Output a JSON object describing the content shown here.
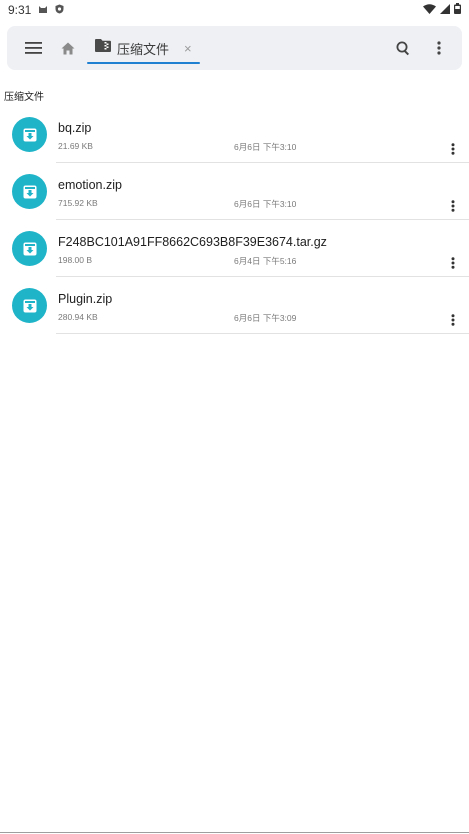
{
  "status_bar": {
    "time": "9:31",
    "icons": [
      "notification-cat-icon",
      "shield-icon",
      "wifi-icon",
      "signal-icon",
      "battery-icon"
    ]
  },
  "toolbar": {
    "tab_label": "压缩文件",
    "tab_close": "×",
    "icons": [
      "menu-icon",
      "home-icon",
      "folder-archive-icon",
      "search-icon",
      "more-vert-icon"
    ],
    "accent": "#1f7fd1"
  },
  "breadcrumb": "压缩文件",
  "files": [
    {
      "name": "bq.zip",
      "size": "21.69 KB",
      "date": "6月6日 下午3:10"
    },
    {
      "name": "emotion.zip",
      "size": "715.92 KB",
      "date": "6月6日 下午3:10"
    },
    {
      "name": "F248BC101A91FF8662C693B8F39E3674.tar.gz",
      "size": "198.00 B",
      "date": "6月4日 下午5:16"
    },
    {
      "name": "Plugin.zip",
      "size": "280.94 KB",
      "date": "6月6日 下午3:09"
    }
  ],
  "colors": {
    "file_icon_bg": "#1fb4c8",
    "toolbar_bg": "#eef0f4"
  }
}
